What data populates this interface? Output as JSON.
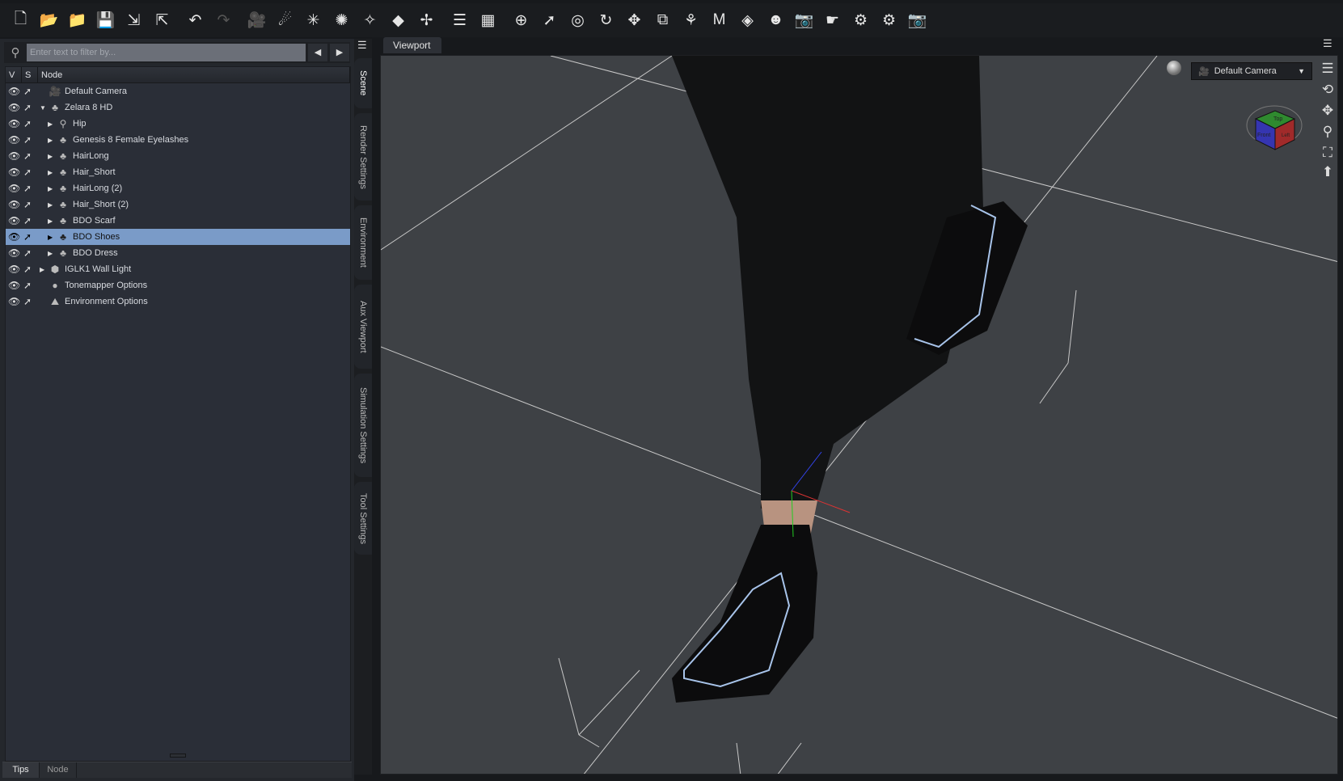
{
  "toolbar": {
    "icons": [
      "new-file-icon",
      "open-icon",
      "open-folder-icon",
      "save-icon",
      "import-icon",
      "export-icon",
      "undo-icon",
      "redo-icon",
      "camera-add-icon",
      "distant-light-icon",
      "spot-light-icon",
      "point-light-icon",
      "linear-light-icon",
      "primitive-icon",
      "null-icon",
      "align-icon",
      "grid-icon",
      "universal-tool-icon",
      "node-select-icon",
      "rotate-tool-icon",
      "rotate-icon",
      "translate-icon",
      "scale-icon",
      "joint-editor-icon",
      "morph-icon",
      "geometry-editor-icon",
      "figure-icon",
      "camera-settings-icon",
      "active-pose-icon",
      "render-settings-icon",
      "render-icon",
      "snapshot-icon"
    ]
  },
  "scene": {
    "filter_placeholder": "Enter text to filter by...",
    "columns": {
      "v": "V",
      "s": "S",
      "node": "Node"
    },
    "nodes": [
      {
        "label": "Default Camera",
        "indent": 0,
        "expander": "",
        "icon": "camera"
      },
      {
        "label": "Zelara 8 HD",
        "indent": 0,
        "expander": "expanded",
        "icon": "figure"
      },
      {
        "label": "Hip",
        "indent": 1,
        "expander": "collapsed",
        "icon": "bone"
      },
      {
        "label": "Genesis 8 Female Eyelashes",
        "indent": 1,
        "expander": "collapsed",
        "icon": "figure"
      },
      {
        "label": "HairLong",
        "indent": 1,
        "expander": "collapsed",
        "icon": "figure"
      },
      {
        "label": "Hair_Short",
        "indent": 1,
        "expander": "collapsed",
        "icon": "figure"
      },
      {
        "label": "HairLong (2)",
        "indent": 1,
        "expander": "collapsed",
        "icon": "figure"
      },
      {
        "label": "Hair_Short (2)",
        "indent": 1,
        "expander": "collapsed",
        "icon": "figure"
      },
      {
        "label": "BDO Scarf",
        "indent": 1,
        "expander": "collapsed",
        "icon": "figure"
      },
      {
        "label": "BDO Shoes",
        "indent": 1,
        "expander": "collapsed",
        "icon": "figure",
        "selected": true
      },
      {
        "label": "BDO Dress",
        "indent": 1,
        "expander": "collapsed",
        "icon": "figure"
      },
      {
        "label": "IGLK1 Wall Light",
        "indent": 0,
        "expander": "collapsed",
        "icon": "light"
      },
      {
        "label": "Tonemapper Options",
        "indent": 0,
        "expander": "",
        "icon": "tonemapper"
      },
      {
        "label": "Environment Options",
        "indent": 0,
        "expander": "",
        "icon": "environment"
      }
    ]
  },
  "bottom_tabs": [
    "Tips",
    "Node"
  ],
  "side_tabs": [
    "Scene",
    "Render Settings",
    "Environment",
    "Aux Viewport",
    "Simulation Settings",
    "Tool Settings"
  ],
  "viewport": {
    "tab": "Viewport",
    "camera": "Default Camera",
    "cube_faces": {
      "top": "Top",
      "front": "Front",
      "right": "Left"
    },
    "selection_color": "#7a9bc8"
  }
}
